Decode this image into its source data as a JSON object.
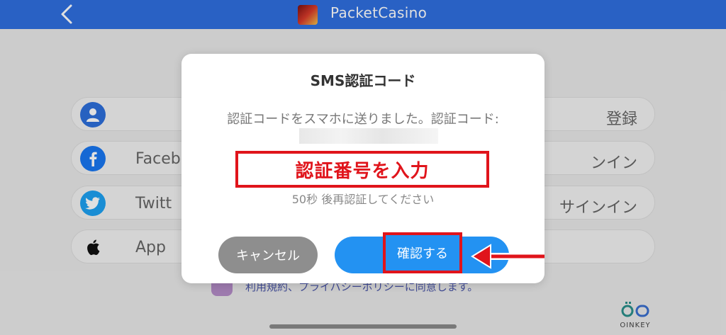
{
  "header": {
    "title": "PacketCasino"
  },
  "login_rows": [
    {
      "left_label": "",
      "right_label": "登録"
    },
    {
      "left_label": "Facebo",
      "right_label": "ンイン"
    },
    {
      "left_label": "Twitt",
      "right_label": "サインイン"
    },
    {
      "left_label": "App",
      "right_label": ""
    }
  ],
  "consent": {
    "text": "利用規約、プライバシーポリシーに同意します。"
  },
  "brand": {
    "text": "OINKEY"
  },
  "dialog": {
    "title": "SMS認証コード",
    "message": "認証コードをスマホに送りました。認証コード:",
    "code_input_label": "認証番号を入力",
    "countdown": "50秒 後再認証してください",
    "cancel_label": "キャンセル",
    "confirm_label": "確認する"
  },
  "colors": {
    "header": "#2f6fe0",
    "accent_red": "#e0141b",
    "confirm_blue": "#2392f2",
    "cancel_gray": "#8e8e8e"
  }
}
